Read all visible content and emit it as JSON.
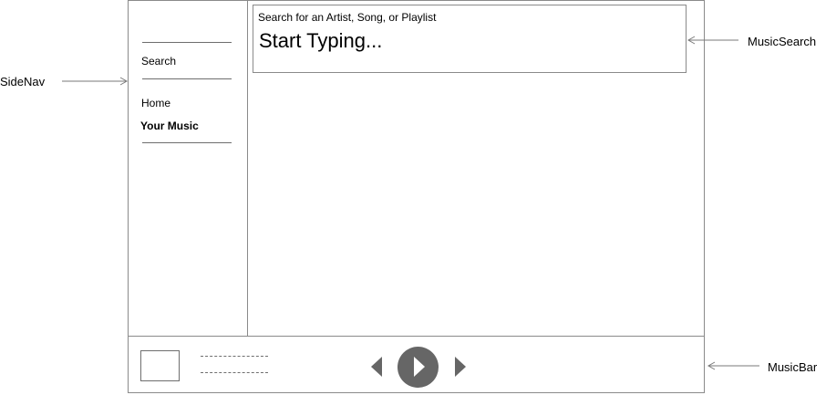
{
  "sidenav": {
    "items": [
      {
        "label": "Search",
        "bold": false
      },
      {
        "label": "Home",
        "bold": false
      },
      {
        "label": "Your Music",
        "bold": true
      }
    ]
  },
  "music_search": {
    "label": "Search for an Artist, Song, or Playlist",
    "placeholder": "Start Typing..."
  },
  "music_bar": {
    "controls": [
      "previous",
      "play",
      "next"
    ]
  },
  "annotations": {
    "sidenav": "SideNav",
    "music_search": "MusicSearch",
    "music_bar": "MusicBar"
  },
  "colors": {
    "border": "#8a8a8a",
    "control_fill": "#666666",
    "play_glyph": "#ffffff"
  },
  "icons": {
    "previous": "triangle-left-icon",
    "play": "play-icon",
    "next": "triangle-right-icon"
  }
}
